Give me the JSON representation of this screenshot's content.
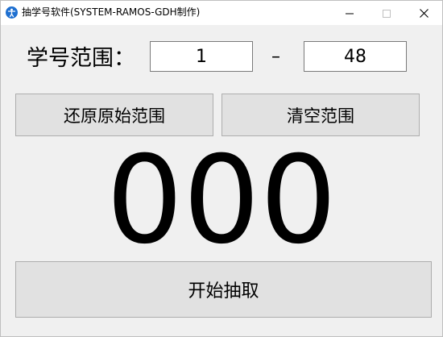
{
  "window": {
    "title": "抽学号软件(SYSTEM-RAMOS-GDH制作)",
    "icon": "accessibility-person-icon",
    "controls": {
      "minimize_icon": "minimize-icon",
      "maximize_icon": "maximize-icon",
      "close_icon": "close-icon"
    }
  },
  "range": {
    "label": "学号范围：",
    "min_value": "1",
    "separator": "–",
    "max_value": "48"
  },
  "buttons": {
    "restore": "还原原始范围",
    "clear": "清空范围",
    "start": "开始抽取"
  },
  "result": {
    "number": "000"
  },
  "colors": {
    "background": "#f0f0f0",
    "button_face": "#e1e1e1",
    "icon_blue": "#1e6fd0"
  }
}
